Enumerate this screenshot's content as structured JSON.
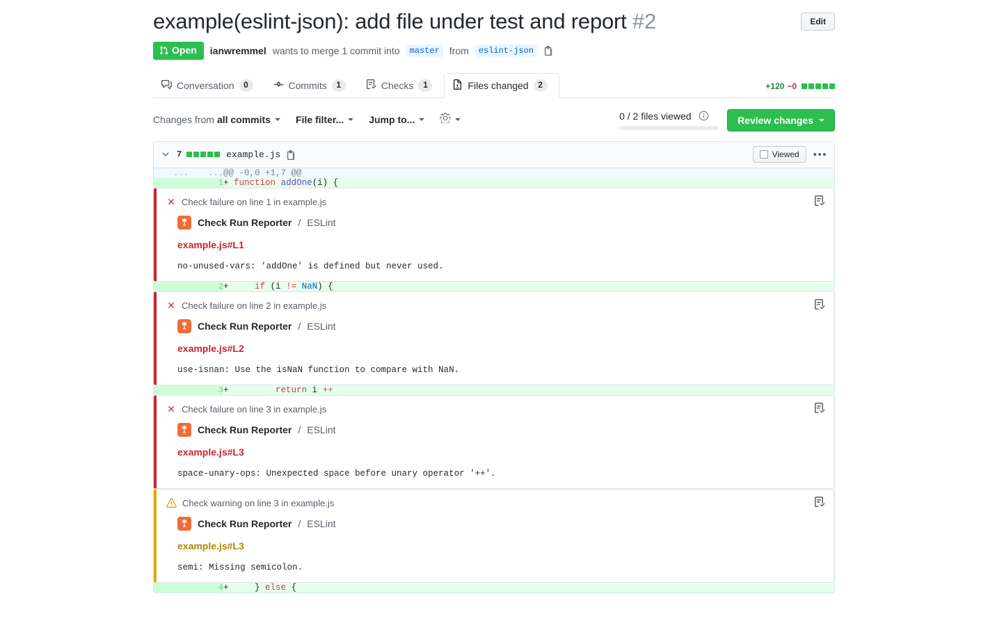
{
  "header": {
    "title": "example(eslint-json): add file under test and report",
    "number": "#2",
    "edit_label": "Edit",
    "state": "Open",
    "author": "ianwremmel",
    "meta_text_1": "wants to merge 1 commit into",
    "base_branch": "master",
    "meta_text_2": "from",
    "head_branch": "eslint-json",
    "copy_icon": "copy-icon"
  },
  "tabs": [
    {
      "label": "Conversation",
      "count": "0",
      "icon": "comment-discussion-icon",
      "selected": false
    },
    {
      "label": "Commits",
      "count": "1",
      "icon": "git-commit-icon",
      "selected": false
    },
    {
      "label": "Checks",
      "count": "1",
      "icon": "checklist-icon",
      "selected": false
    },
    {
      "label": "Files changed",
      "count": "2",
      "icon": "file-diff-icon",
      "selected": true
    }
  ],
  "diffstat": {
    "additions": "+120",
    "deletions": "−0",
    "blocks": [
      "g",
      "g",
      "g",
      "g",
      "g"
    ]
  },
  "toolbar": {
    "changes_from_prefix": "Changes from",
    "changes_from_value": "all commits",
    "file_filter": "File filter...",
    "jump_to": "Jump to...",
    "gear_icon": "gear-icon",
    "files_viewed": "0 / 2 files viewed",
    "info_icon": "info-icon",
    "review_changes": "Review changes"
  },
  "file": {
    "chevron_icon": "chevron-down-icon",
    "change_count": "7",
    "blocks": [
      "g",
      "g",
      "g",
      "g",
      "g"
    ],
    "name": "example.js",
    "copy_icon": "copy-path-icon",
    "viewed_label": "Viewed",
    "kebab_icon": "kebab-horizontal-icon"
  },
  "diff_rows": [
    {
      "type": "hunk",
      "old_ln": "...",
      "new_ln": "...",
      "text": "@@ -0,0 +1,7 @@"
    },
    {
      "type": "add",
      "new_ln": "1",
      "marker": "+",
      "tokens": [
        {
          "t": " ",
          "c": "plain"
        },
        {
          "t": "function",
          "c": "kw"
        },
        {
          "t": " ",
          "c": "plain"
        },
        {
          "t": "addOne",
          "c": "fn"
        },
        {
          "t": "(i) {",
          "c": "plain"
        }
      ]
    },
    {
      "type": "annotation",
      "severity": "failure",
      "title": "Check failure on line 1 in example.js",
      "reporter": "Check Run Reporter",
      "reporter_sep": "/",
      "reporter_check": "ESLint",
      "location": "example.js#L1",
      "message": "no-unused-vars: 'addOne' is defined but never used.",
      "tool_icon": "checks-icon",
      "avatar_icon": "check-run-reporter-avatar"
    },
    {
      "type": "add",
      "new_ln": "2",
      "marker": "+",
      "tokens": [
        {
          "t": "     ",
          "c": "plain"
        },
        {
          "t": "if",
          "c": "kw"
        },
        {
          "t": " (i ",
          "c": "plain"
        },
        {
          "t": "!=",
          "c": "kw"
        },
        {
          "t": " ",
          "c": "plain"
        },
        {
          "t": "NaN",
          "c": "const"
        },
        {
          "t": ") {",
          "c": "plain"
        }
      ]
    },
    {
      "type": "annotation",
      "severity": "failure",
      "title": "Check failure on line 2 in example.js",
      "reporter": "Check Run Reporter",
      "reporter_sep": "/",
      "reporter_check": "ESLint",
      "location": "example.js#L2",
      "message": "use-isnan: Use the isNaN function to compare with NaN.",
      "tool_icon": "checks-icon",
      "avatar_icon": "check-run-reporter-avatar"
    },
    {
      "type": "add",
      "new_ln": "3",
      "marker": "+",
      "tokens": [
        {
          "t": "         ",
          "c": "plain"
        },
        {
          "t": "return",
          "c": "kw"
        },
        {
          "t": " i ",
          "c": "plain"
        },
        {
          "t": "++",
          "c": "kw"
        }
      ]
    },
    {
      "type": "annotation",
      "severity": "failure",
      "title": "Check failure on line 3 in example.js",
      "reporter": "Check Run Reporter",
      "reporter_sep": "/",
      "reporter_check": "ESLint",
      "location": "example.js#L3",
      "message": "space-unary-ops: Unexpected space before unary operator '++'.",
      "tool_icon": "checks-icon",
      "avatar_icon": "check-run-reporter-avatar"
    },
    {
      "type": "annotation",
      "severity": "warning",
      "title": "Check warning on line 3 in example.js",
      "reporter": "Check Run Reporter",
      "reporter_sep": "/",
      "reporter_check": "ESLint",
      "location": "example.js#L3",
      "message": "semi: Missing semicolon.",
      "tool_icon": "checks-icon",
      "avatar_icon": "check-run-reporter-avatar"
    },
    {
      "type": "add",
      "new_ln": "4",
      "marker": "+",
      "tokens": [
        {
          "t": "     ",
          "c": "plain"
        },
        {
          "t": "} ",
          "c": "plain"
        },
        {
          "t": "else",
          "c": "kw"
        },
        {
          "t": " {",
          "c": "plain"
        }
      ]
    }
  ],
  "colors": {
    "open_green": "#2cbe4e",
    "addition_green": "#22863a",
    "deletion_red": "#cb2431",
    "warning_yellow": "#dbab09",
    "link_blue": "#0366d6",
    "avatar_orange": "#f26b38"
  }
}
